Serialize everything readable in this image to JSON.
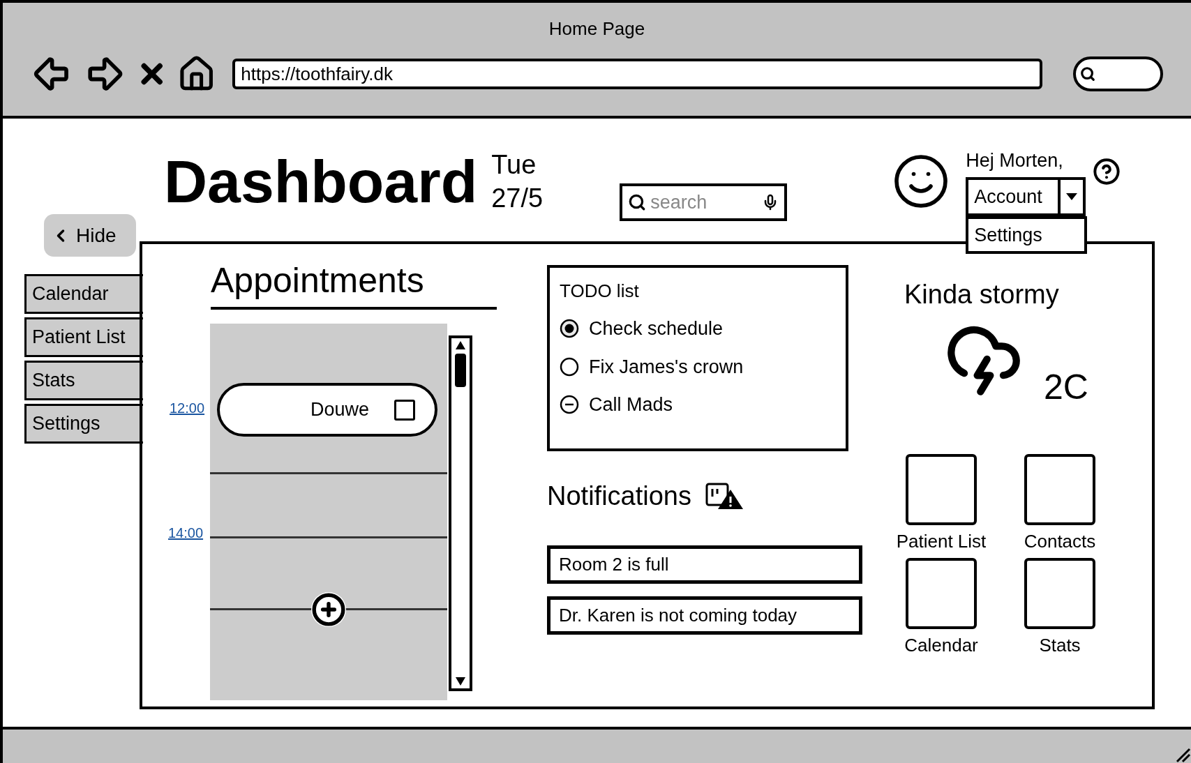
{
  "window": {
    "title": "Home Page"
  },
  "browser": {
    "url": "https://toothfairy.dk"
  },
  "header": {
    "title": "Dashboard",
    "day": "Tue",
    "date": "27/5",
    "search": {
      "placeholder": "search"
    },
    "greeting": "Hej Morten,",
    "account": {
      "label": "Account",
      "menu": [
        {
          "label": "Settings"
        }
      ]
    }
  },
  "hide_button": {
    "label": "Hide"
  },
  "sidebar": {
    "tabs": [
      {
        "label": "Calendar"
      },
      {
        "label": "Patient List"
      },
      {
        "label": "Stats"
      },
      {
        "label": "Settings"
      }
    ]
  },
  "appointments": {
    "title": "Appointments",
    "times": [
      "12:00",
      "14:00"
    ],
    "events": [
      {
        "name": "Douwe",
        "checked": false
      }
    ]
  },
  "todo": {
    "title": "TODO list",
    "items": [
      {
        "label": "Check schedule",
        "kind": "radio",
        "selected": true
      },
      {
        "label": "Fix James's crown",
        "kind": "radio",
        "selected": false
      },
      {
        "label": "Call Mads",
        "kind": "mixed",
        "selected": false
      }
    ]
  },
  "notifications": {
    "title": "Notifications",
    "items": [
      "Room 2 is full",
      "Dr. Karen is not coming today"
    ]
  },
  "weather": {
    "summary": "Kinda stormy",
    "temperature": "2C"
  },
  "shortcuts": [
    {
      "label": "Patient List"
    },
    {
      "label": "Contacts"
    },
    {
      "label": "Calendar"
    },
    {
      "label": "Stats"
    }
  ]
}
